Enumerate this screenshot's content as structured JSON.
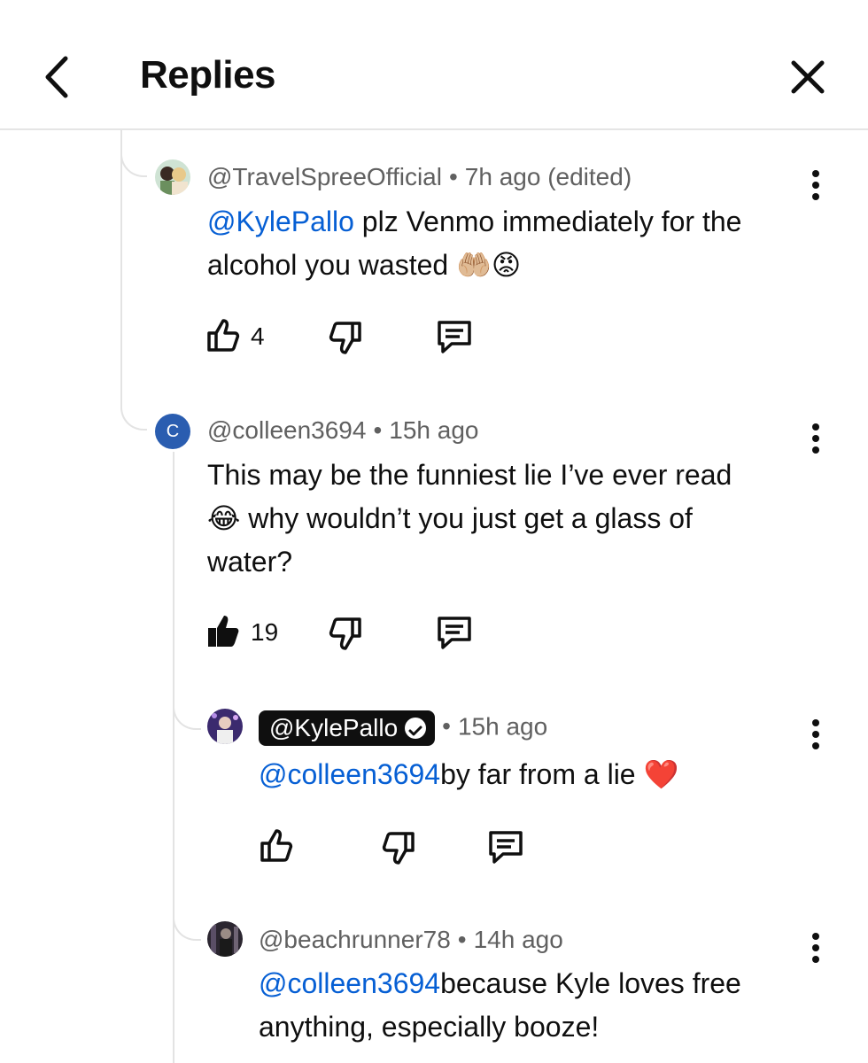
{
  "header": {
    "title": "Replies"
  },
  "comments": [
    {
      "author": "@TravelSpreeOfficial",
      "time": "7h ago (edited)",
      "mention": "@KylePallo",
      "line1": " plz Venmo immediately for the",
      "line2": "alcohol you wasted",
      "emoji": "🤲🏼😡",
      "likes": "4"
    },
    {
      "author": "@colleen3694",
      "avatar_letter": "C",
      "time": "15h ago",
      "line1": "This may be the funniest lie I’ve ever read",
      "emoji": "😂",
      "line2": " why wouldn’t you just get a glass of",
      "line3": "water?",
      "likes": "19"
    },
    {
      "author": "@KylePallo",
      "time": "15h ago",
      "mention": "@colleen3694",
      "line1": "by far from a lie",
      "emoji": "❤️"
    },
    {
      "author": "@beachrunner78",
      "time": "14h ago",
      "mention": "@colleen3694",
      "line1": "because Kyle loves free",
      "line2": "anything, especially booze!"
    }
  ],
  "colors": {
    "mention": "#065fd4",
    "avatar_c": "#2a5db0",
    "heart": "#e0245e"
  }
}
